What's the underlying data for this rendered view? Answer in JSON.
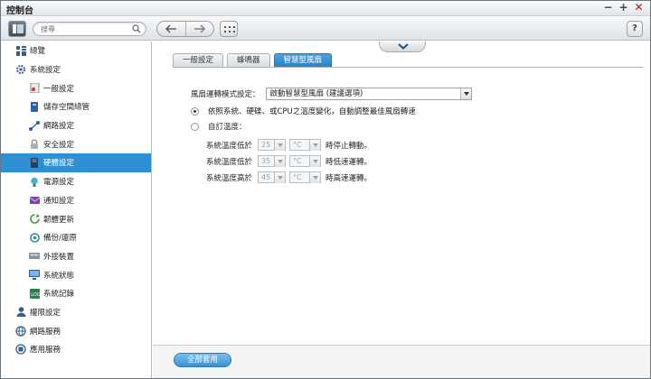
{
  "window": {
    "title": "控制台",
    "controls": [
      "minimize",
      "maximize",
      "close"
    ]
  },
  "toolbar": {
    "search_placeholder": "搜尋",
    "help_label": "?"
  },
  "sidebar": {
    "items": [
      {
        "label": "總覽",
        "icon": "overview-icon"
      },
      {
        "label": "系統設定",
        "icon": "gear-icon"
      },
      {
        "label": "一般設定",
        "icon": "general-settings-icon"
      },
      {
        "label": "儲存空間總管",
        "icon": "storage-icon"
      },
      {
        "label": "網路設定",
        "icon": "network-icon"
      },
      {
        "label": "安全設定",
        "icon": "lock-icon"
      },
      {
        "label": "硬體設定",
        "icon": "hardware-icon"
      },
      {
        "label": "電源設定",
        "icon": "power-icon"
      },
      {
        "label": "通知設定",
        "icon": "notification-icon"
      },
      {
        "label": "韌體更新",
        "icon": "firmware-icon"
      },
      {
        "label": "備份/還原",
        "icon": "backup-icon"
      },
      {
        "label": "外接裝置",
        "icon": "external-device-icon"
      },
      {
        "label": "系統狀態",
        "icon": "system-status-icon"
      },
      {
        "label": "系統記錄",
        "icon": "system-log-icon"
      },
      {
        "label": "權限設定",
        "icon": "user-icon"
      },
      {
        "label": "網路服務",
        "icon": "globe-icon"
      },
      {
        "label": "應用服務",
        "icon": "apps-icon"
      }
    ],
    "active": "硬體設定"
  },
  "tabs": [
    {
      "label": "一般設定"
    },
    {
      "label": "蜂鳴器"
    },
    {
      "label": "智慧型風扇"
    }
  ],
  "form": {
    "fan_mode_label": "風扇運轉模式設定：",
    "fan_mode_value": "啟動智慧型風扇 (建議選項)",
    "option_auto": "依照系統、硬碟、或CPU之溫度變化，自動調整最佳風扇轉速",
    "option_custom": "自訂溫度：",
    "temp_rows": [
      {
        "prefix": "系統溫度低於",
        "value": "25",
        "unit": "°C",
        "suffix": "時停止轉動。"
      },
      {
        "prefix": "系統溫度低於",
        "value": "35",
        "unit": "°C",
        "suffix": "時低速運轉。"
      },
      {
        "prefix": "系統溫度高於",
        "value": "45",
        "unit": "°C",
        "suffix": "時高速運轉。"
      }
    ]
  },
  "footer": {
    "apply_label": "全部套用"
  },
  "colors": {
    "accent": "#2e8fd3",
    "close": "#c0141a"
  }
}
